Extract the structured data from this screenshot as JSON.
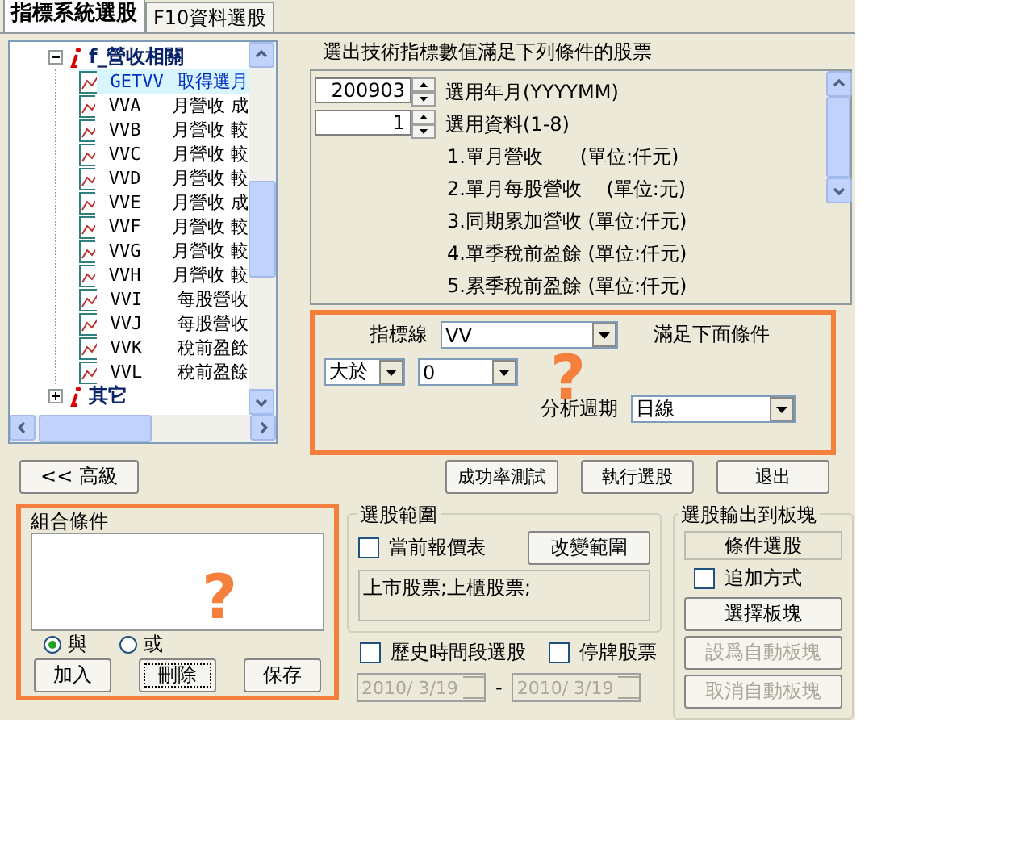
{
  "tabs": [
    {
      "label": "指標系統選股",
      "selected": true
    },
    {
      "label": "F10資料選股",
      "selected": false
    }
  ],
  "tree": {
    "groups": [
      {
        "label": "f_營收相關",
        "expanded": true,
        "children": [
          {
            "code": "GETVV",
            "label": "取得選月",
            "selected": true
          },
          {
            "code": "VVA",
            "label": "月營收 成",
            "selected": false
          },
          {
            "code": "VVB",
            "label": "月營收 較",
            "selected": false
          },
          {
            "code": "VVC",
            "label": "月營收 較",
            "selected": false
          },
          {
            "code": "VVD",
            "label": "月營收 較",
            "selected": false
          },
          {
            "code": "VVE",
            "label": "月營收 成",
            "selected": false
          },
          {
            "code": "VVF",
            "label": "月營收 較",
            "selected": false
          },
          {
            "code": "VVG",
            "label": "月營收 較",
            "selected": false
          },
          {
            "code": "VVH",
            "label": "月營收 較",
            "selected": false
          },
          {
            "code": "VVI",
            "label": "每股營收",
            "selected": false
          },
          {
            "code": "VVJ",
            "label": "每股營收",
            "selected": false
          },
          {
            "code": "VVK",
            "label": "稅前盈餘",
            "selected": false
          },
          {
            "code": "VVL",
            "label": "稅前盈餘",
            "selected": false
          }
        ]
      },
      {
        "label": "其它",
        "expanded": false
      }
    ]
  },
  "criteria": {
    "heading": "選出技術指標數值滿足下列條件的股票",
    "spinners": [
      {
        "value": "200903",
        "label": "選用年月(YYYYMM)"
      },
      {
        "value": "1",
        "label": "選用資料(1-8)"
      }
    ],
    "options": [
      "1.單月營收      (單位:仟元)",
      "2.單月每股營收    (單位:元)",
      "3.同期累加營收 (單位:仟元)",
      "4.單季稅前盈餘 (單位:仟元)",
      "5.累季稅前盈餘 (單位:仟元)"
    ]
  },
  "condition": {
    "indicator_label": "指標線",
    "indicator": "VV",
    "satisfy_label": "滿足下面條件",
    "operator": "大於",
    "value": "0",
    "period_label": "分析週期",
    "period": "日線",
    "annotation": "?"
  },
  "advanced_button": "<< 高級",
  "action_buttons": [
    "成功率測試",
    "執行選股",
    "退出"
  ],
  "combine": {
    "title": "組合條件",
    "radios": [
      {
        "label": "與",
        "selected": true
      },
      {
        "label": "或",
        "selected": false
      }
    ],
    "buttons": [
      {
        "label": "加入",
        "focused": false
      },
      {
        "label": "刪除",
        "focused": true
      },
      {
        "label": "保存",
        "focused": false
      }
    ],
    "annotation": "?"
  },
  "range": {
    "title": "選股範圍",
    "quote_checkbox": {
      "label": "當前報價表",
      "checked": false
    },
    "change_button": "改變範圍",
    "scope_text": "上市股票;上櫃股票;",
    "history_checkbox": {
      "label": "歷史時間段選股",
      "checked": false
    },
    "suspended_checkbox": {
      "label": "停牌股票",
      "checked": false
    },
    "date_from": {
      "value": "2010/ 3/19",
      "disabled": true
    },
    "date_separator": "-",
    "date_to": {
      "value": "2010/ 3/19",
      "disabled": true
    }
  },
  "output": {
    "title": "選股輸出到板塊",
    "block_name": "條件選股",
    "append_checkbox": {
      "label": "追加方式",
      "checked": false
    },
    "buttons": [
      {
        "label": "選擇板塊",
        "disabled": false
      },
      {
        "label": "設爲自動板塊",
        "disabled": true
      },
      {
        "label": "取消自動板塊",
        "disabled": true
      }
    ]
  }
}
